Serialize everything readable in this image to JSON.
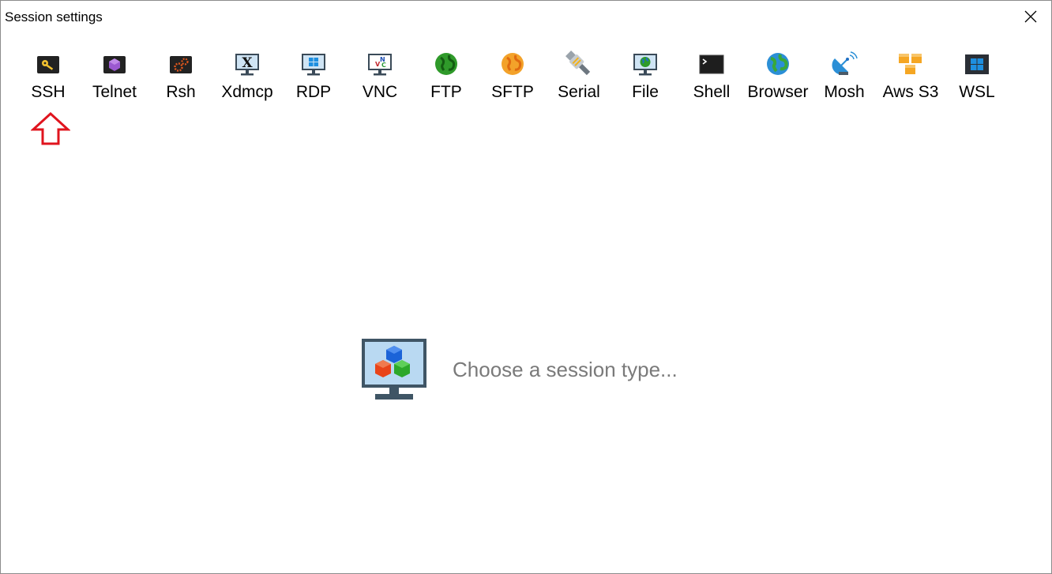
{
  "window": {
    "title": "Session settings"
  },
  "session_types": [
    {
      "label": "SSH",
      "icon": "key-icon"
    },
    {
      "label": "Telnet",
      "icon": "telnet-icon"
    },
    {
      "label": "Rsh",
      "icon": "gears-icon"
    },
    {
      "label": "Xdmcp",
      "icon": "x-monitor-icon"
    },
    {
      "label": "RDP",
      "icon": "windows-monitor-icon"
    },
    {
      "label": "VNC",
      "icon": "vnc-monitor-icon"
    },
    {
      "label": "FTP",
      "icon": "green-globe-icon"
    },
    {
      "label": "SFTP",
      "icon": "orange-globe-icon"
    },
    {
      "label": "Serial",
      "icon": "plug-icon"
    },
    {
      "label": "File",
      "icon": "globe-monitor-icon"
    },
    {
      "label": "Shell",
      "icon": "terminal-icon"
    },
    {
      "label": "Browser",
      "icon": "earth-icon"
    },
    {
      "label": "Mosh",
      "icon": "satellite-dish-icon"
    },
    {
      "label": "Aws S3",
      "icon": "boxes-icon"
    },
    {
      "label": "WSL",
      "icon": "windows-tile-icon"
    }
  ],
  "placeholder": {
    "text": "Choose a session type...",
    "icon": "cubes-monitor-icon"
  },
  "colors": {
    "arrow": "#e0141e",
    "placeholder_text": "#7a7a7a"
  }
}
